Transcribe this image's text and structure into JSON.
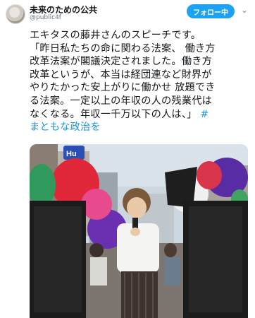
{
  "header": {
    "display_name": "未来のための公共",
    "handle": "@public4f",
    "follow_label": "フォロー中"
  },
  "tweet": {
    "lines": [
      "エキタスの藤井さんのスピーチです。",
      "「昨日私たちの命に関わる法案、 働き方",
      "改革法案が閣議決定されました。働き方",
      "改革というが、本当は経団連など財界が",
      "やりたかった安上がりに働かせ 放題でき",
      "る法案。一定以上の年収の人の残業代は",
      "なくなる。年収一千万以下の人は、」"
    ],
    "trailing_hash": "#",
    "hashtag": "まともな政治を"
  },
  "photo": {
    "sign_text": "Hu"
  },
  "icons": [
    "avatar",
    "chevron-down-icon"
  ],
  "colors": {
    "accent": "#1da1f2",
    "hashtag": "#1b95e0",
    "text": "#14171a",
    "muted": "#657786"
  }
}
